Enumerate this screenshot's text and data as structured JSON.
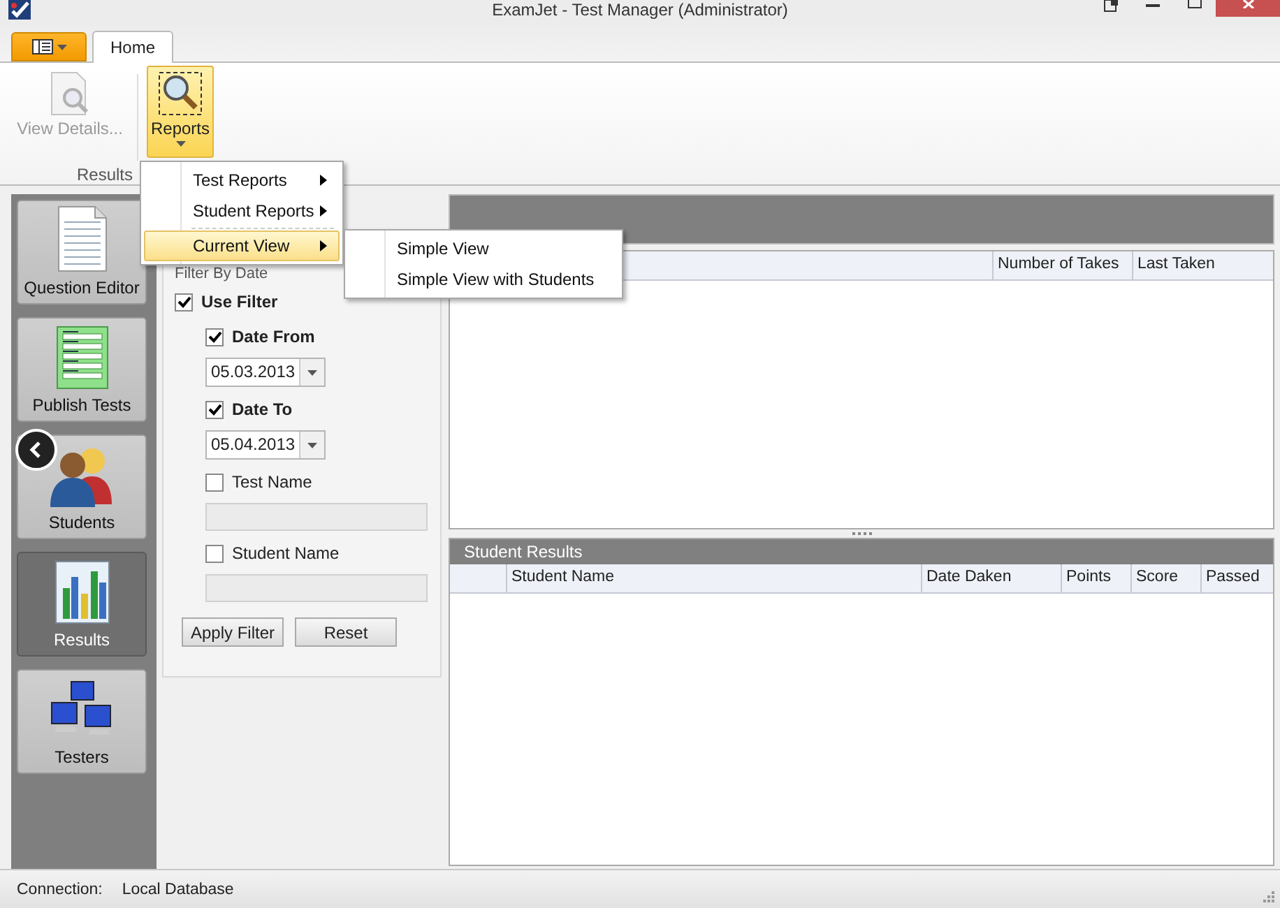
{
  "window": {
    "title": "ExamJet - Test Manager (Administrator)"
  },
  "ribbon": {
    "tabs": [
      {
        "label": "Home",
        "selected": true
      }
    ],
    "buttons": [
      {
        "label": "View Details...",
        "kind": "details",
        "disabled": true,
        "selected": false
      },
      {
        "label": "Reports",
        "kind": "reports",
        "disabled": false,
        "selected": true
      }
    ],
    "group": "Results"
  },
  "menu": {
    "items": [
      {
        "label": "Test Reports",
        "selected": false
      },
      {
        "label": "Student Reports",
        "selected": false
      },
      {
        "label": "Current View",
        "selected": true
      }
    ]
  },
  "submenu": {
    "items": [
      {
        "label": "Simple View"
      },
      {
        "label": "Simple View with Students"
      }
    ]
  },
  "nav": [
    {
      "label": "Question Editor",
      "kind": "document",
      "selected": false
    },
    {
      "label": "Publish Tests",
      "kind": "form",
      "selected": false
    },
    {
      "label": "Students",
      "kind": "people",
      "selected": false
    },
    {
      "label": "Results",
      "kind": "chart",
      "selected": true
    },
    {
      "label": "Testers",
      "kind": "network",
      "selected": false
    }
  ],
  "filter": {
    "title": "Filter By Date",
    "use_filter": {
      "label": "Use Filter",
      "checked": true
    },
    "fields": [
      {
        "kind": "date",
        "label": "Date From",
        "checked": true,
        "value": "05.03.2013"
      },
      {
        "kind": "date",
        "label": "Date To",
        "checked": true,
        "value": "05.04.2013"
      },
      {
        "kind": "text",
        "label": "Test Name",
        "checked": false
      },
      {
        "kind": "text",
        "label": "Student Name",
        "checked": false
      }
    ],
    "buttons": [
      "Apply Filter",
      "Reset"
    ]
  },
  "tests_grid": {
    "columns": [
      "Number of Takes",
      "Last Taken"
    ]
  },
  "results_grid": {
    "title": "Student Results",
    "columns": [
      "Student Name",
      "Date Daken",
      "Points",
      "Score",
      "Passed"
    ]
  },
  "status_bar": {
    "label": "Connection:",
    "value": "Local Database"
  }
}
